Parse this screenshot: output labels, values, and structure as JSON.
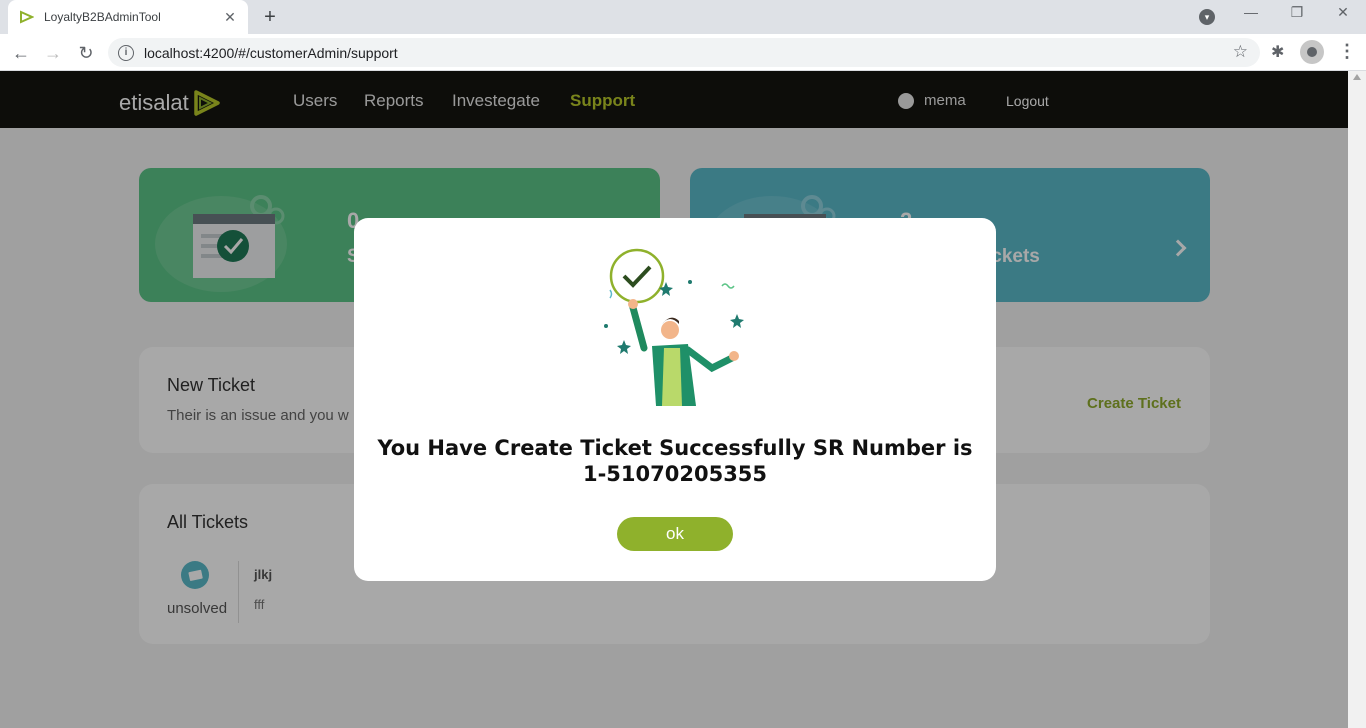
{
  "browser": {
    "tab_title": "LoyaltyB2BAdminTool",
    "tab_close": "✕",
    "new_tab": "+",
    "url": "localhost:4200/#/customerAdmin/support"
  },
  "header": {
    "logo_text": "etisalat",
    "nav": [
      "Users",
      "Reports",
      "Investegate",
      "Support"
    ],
    "active_nav": "Support",
    "username": "mema",
    "logout": "Logout"
  },
  "stats": {
    "solved_count": "0",
    "solved_label_visible": "S",
    "open_count": "2",
    "open_label_visible": "ickets"
  },
  "new_ticket": {
    "title": "New Ticket",
    "description_visible": "Their is an issue and you w",
    "create_link": "Create Ticket"
  },
  "all_tickets": {
    "title": "All Tickets",
    "items": [
      {
        "status": "unsolved",
        "title": "jlkj",
        "subtitle": "fff"
      }
    ]
  },
  "modal": {
    "message_line1": "You Have Create Ticket Successfully SR Number is",
    "message_line2": "1-51070205355",
    "ok_button": "ok"
  },
  "colors": {
    "accent_green": "#8fb12c",
    "active_nav": "#b8c82a",
    "card_green": "#5cc487",
    "card_blue": "#5ab9c9",
    "header_bg": "#151510"
  }
}
